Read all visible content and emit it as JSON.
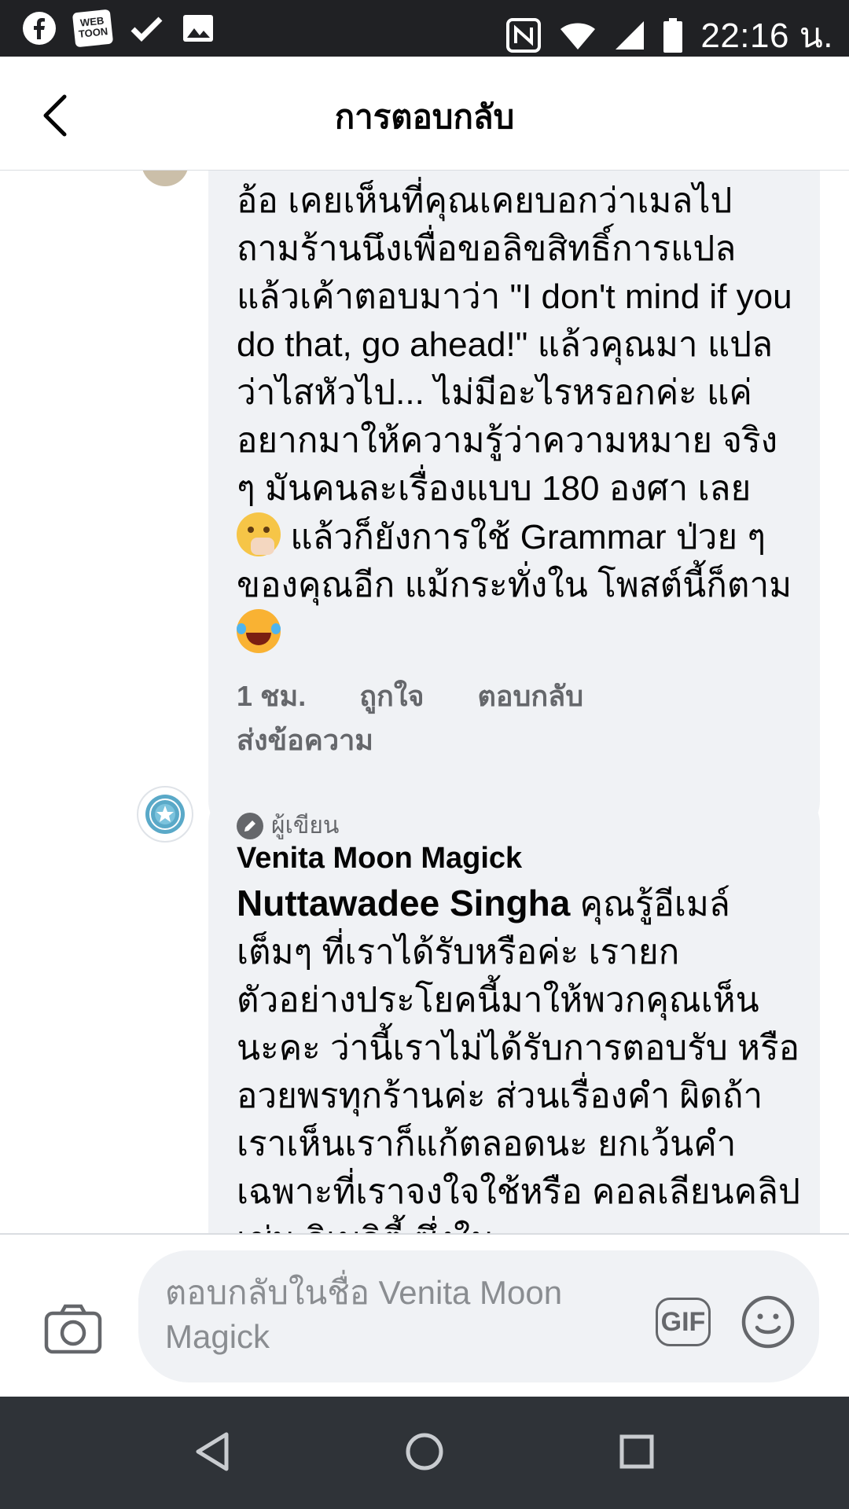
{
  "status_bar": {
    "time": "22:16 น.",
    "left_icons": [
      "facebook-icon",
      "webtoon-icon",
      "check-icon",
      "image-icon"
    ],
    "webtoon_text": "WEB TOON",
    "right_icons": [
      "nfc-icon",
      "wifi-icon",
      "signal-icon",
      "battery-icon"
    ]
  },
  "header": {
    "title": "การตอบกลับ",
    "back_icon": "back-arrow-icon"
  },
  "comments": [
    {
      "text_before_emoji1": "อ้อ เคยเห็นที่คุณเคยบอกว่าเมลไป ถามร้านนึงเพื่อขอลิขสิทธิ์การแปล แล้วเค้าตอบมาว่า \"I don't mind if you do that, go ahead!\" แล้วคุณมา แปลว่าไสหัวไป... ไม่มีอะไรหรอกค่ะ แค่อยากมาให้ความรู้ว่าความหมาย จริง ๆ มันคนละเรื่องแบบ 180 องศา เลย",
      "text_between_emoji": " แล้วก็ยังการใช้ Grammar ป่วย ๆ ของคุณอีก แม้กระทั่งใน โพสต์นี้ก็ตาม",
      "emoji_1": "face-with-hand-over-mouth-icon",
      "emoji_2": "tears-of-joy-icon",
      "time": "1 ชม.",
      "like": "ถูกใจ",
      "reply": "ตอบกลับ",
      "send_message": "ส่งข้อความ"
    },
    {
      "badge": "ผู้เขียน",
      "author": "Venita Moon Magick",
      "mention": "Nuttawadee Singha",
      "text": " คุณรู้อีเมล์ เต็มๆ ที่เราได้รับหรือค่ะ เรายก ตัวอย่างประโยคนี้มาให้พวกคุณเห็น นะคะ ว่านี้เราไม่ได้รับการตอบรับ หรืออวยพรทุกร้านค่ะ ส่วนเรื่องคำ ผิดถ้าเราเห็นเราก็แก้ตลอดนะ ยกเว้นคำเฉพาะที่เราจงใจใช้หรือ คอลเลียนคลิป เช่น ลิเบลิตี้ ซึ่งใน"
    }
  ],
  "composer": {
    "placeholder": "ตอบกลับในชื่อ Venita Moon Magick",
    "gif_label": "GIF",
    "camera_icon": "camera-icon",
    "emoji_icon": "smiley-icon"
  },
  "navbar": {
    "icons": [
      "nav-back-icon",
      "nav-home-icon",
      "nav-recents-icon"
    ]
  },
  "colors": {
    "bubble": "#f0f2f5",
    "secondary_text": "#65676b",
    "status_bar": "#202124",
    "nav_bar": "#2f3338"
  }
}
